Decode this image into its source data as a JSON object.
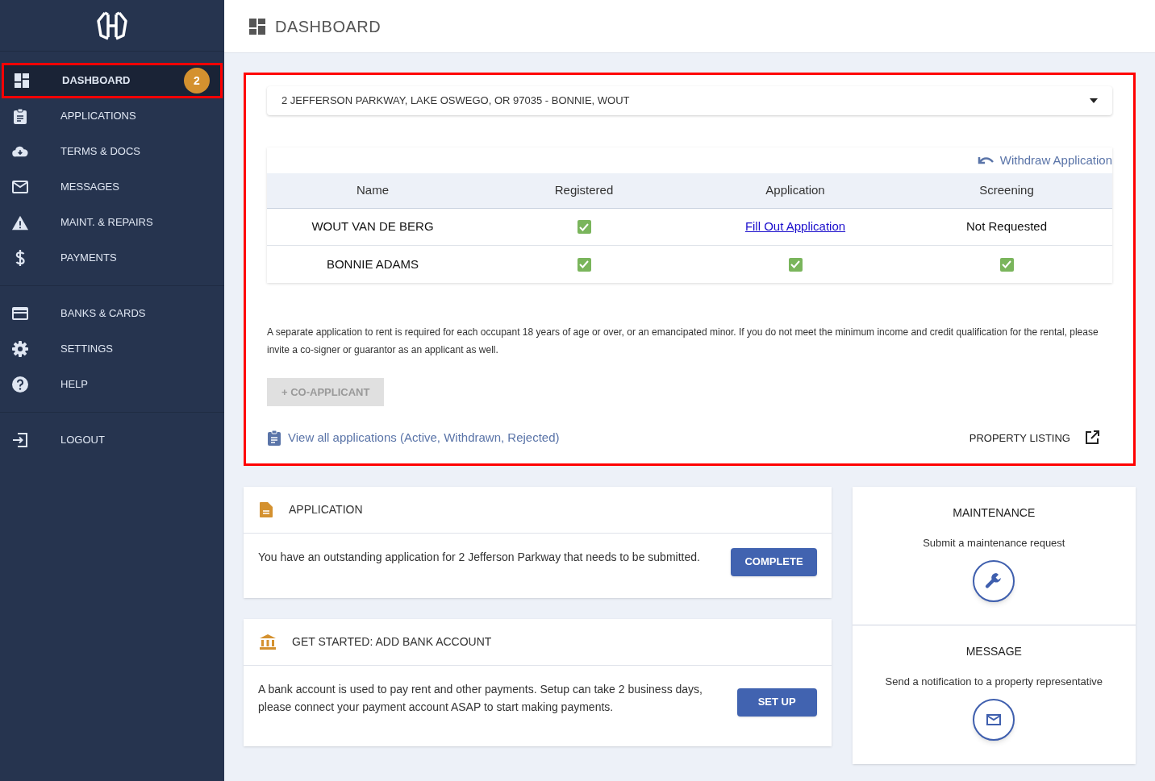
{
  "sidebar": {
    "groups": [
      {
        "items": [
          {
            "label": "DASHBOARD",
            "selected": true,
            "highlighted": true,
            "badge": "2"
          },
          {
            "label": "APPLICATIONS",
            "selected": false,
            "highlighted": false
          },
          {
            "label": "TERMS & DOCS",
            "selected": false,
            "highlighted": false
          },
          {
            "label": "MESSAGES",
            "selected": false,
            "highlighted": false
          },
          {
            "label": "MAINT. & REPAIRS",
            "selected": false,
            "highlighted": false
          },
          {
            "label": "PAYMENTS",
            "selected": false,
            "highlighted": false
          }
        ]
      },
      {
        "items": [
          {
            "label": "BANKS & CARDS",
            "selected": false,
            "highlighted": false
          },
          {
            "label": "SETTINGS",
            "selected": false,
            "highlighted": false
          },
          {
            "label": "HELP",
            "selected": false,
            "highlighted": false
          }
        ]
      },
      {
        "items": [
          {
            "label": "LOGOUT",
            "selected": false,
            "highlighted": false
          }
        ]
      }
    ]
  },
  "header": {
    "title": "DASHBOARD"
  },
  "application_panel": {
    "highlighted": true,
    "property_select": {
      "value": "2 JEFFERSON PARKWAY, LAKE OSWEGO, OR 97035 - BONNIE, WOUT"
    },
    "withdraw_link": "Withdraw Application",
    "table": {
      "columns": [
        "Name",
        "Registered",
        "Application",
        "Screening"
      ],
      "rows": [
        [
          {
            "kind": "text",
            "text": "WOUT VAN DE BERG"
          },
          {
            "kind": "check",
            "checked": true
          },
          {
            "kind": "link",
            "text": "Fill Out Application"
          },
          {
            "kind": "text",
            "text": "Not Requested"
          }
        ],
        [
          {
            "kind": "text",
            "text": "BONNIE ADAMS"
          },
          {
            "kind": "check",
            "checked": true
          },
          {
            "kind": "check",
            "checked": true
          },
          {
            "kind": "check",
            "checked": true
          }
        ]
      ]
    },
    "note": "A separate application to rent is required for each occupant 18 years of age or over, or an emancipated minor. If you do not meet the minimum income and credit qualification for the rental, please invite a co-signer or guarantor as an applicant as well.",
    "co_applicant_button": {
      "label": "+ CO-APPLICANT",
      "disabled": true
    },
    "view_all_link": "View all applications (Active, Withdrawn, Rejected)",
    "property_listing_link": "PROPERTY LISTING"
  },
  "cards": [
    {
      "title": "APPLICATION",
      "text": "You have an outstanding application for 2 Jefferson Parkway that needs to be submitted.",
      "button": "COMPLETE"
    },
    {
      "title": "GET STARTED: ADD BANK ACCOUNT",
      "text": "A bank account is used to pay rent and other payments. Setup can take 2 business days, please connect your payment account ASAP to start making payments.",
      "button": "SET UP"
    }
  ],
  "actions": [
    {
      "title": "MAINTENANCE",
      "text": "Submit a maintenance request"
    },
    {
      "title": "MESSAGE",
      "text": "Send a notification to a property representative"
    }
  ]
}
